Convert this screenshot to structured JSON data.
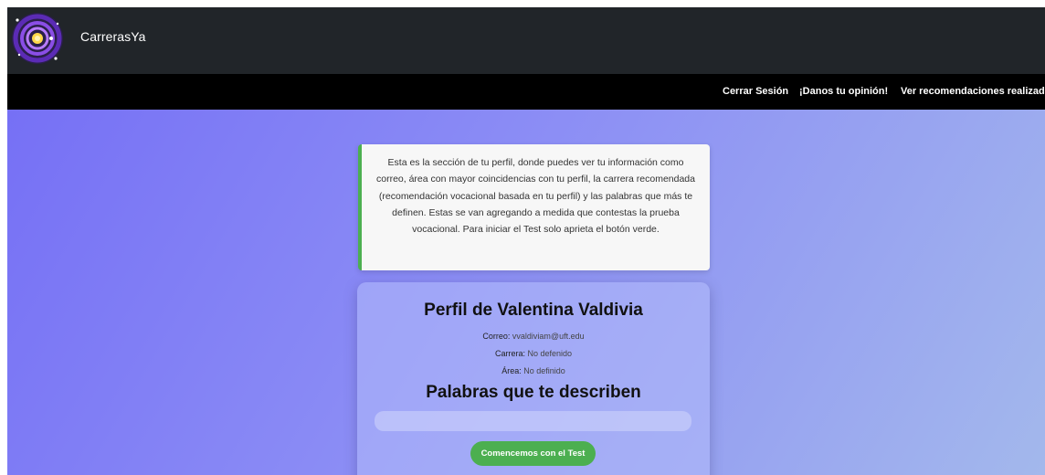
{
  "header": {
    "brand": "CarrerasYa",
    "logo_icon": "galaxy-logo-icon"
  },
  "nav": {
    "logout": "Cerrar Sesión",
    "feedback": "¡Danos tu opinión!",
    "recommendations": "Ver recomendaciones realizadas"
  },
  "info": {
    "text": "Esta es la sección de tu perfil, donde puedes ver tu información como correo, área con mayor coincidencias con tu perfil, la carrera recomendada (recomendación vocacional basada en tu perfil) y las palabras que más te definen. Estas se van agregando a medida que contestas la prueba vocacional. Para iniciar el Test solo aprieta el botón verde."
  },
  "profile": {
    "title": "Perfil de Valentina Valdivia",
    "email_label": "Correo:",
    "email_value": "vvaldiviam@uft.edu",
    "career_label": "Carrera:",
    "career_value": "No defenido",
    "area_label": "Área:",
    "area_value": "No definido",
    "words_title": "Palabras que te describen",
    "start_button": "Comencemos con el Test"
  },
  "colors": {
    "topbar": "#212529",
    "navbar": "#000000",
    "accent_green": "#4caf50"
  }
}
